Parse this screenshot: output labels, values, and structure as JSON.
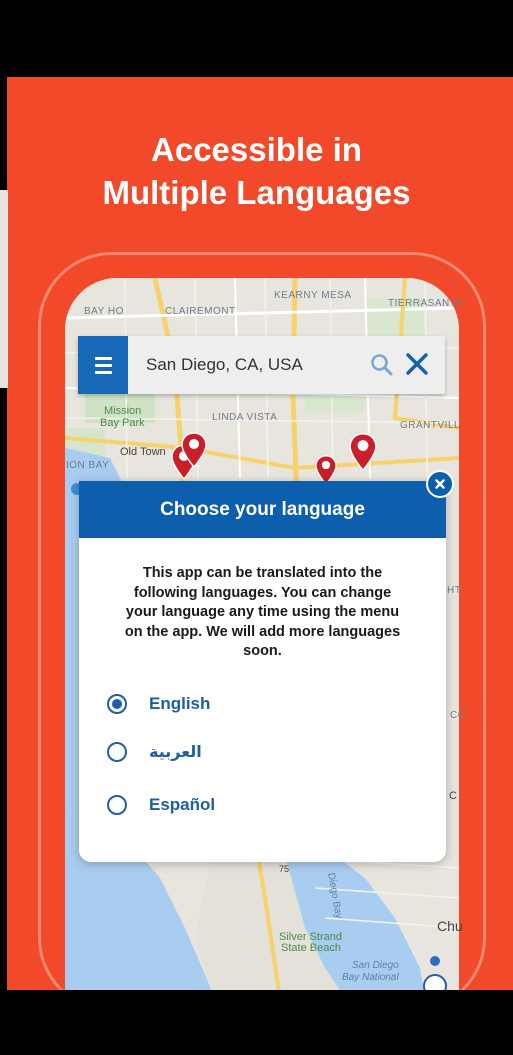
{
  "headline": {
    "line1": "Accessible in",
    "line2": "Multiple Languages"
  },
  "search": {
    "value": "San Diego, CA, USA"
  },
  "map_labels": {
    "bay_ho": "BAY HO",
    "clairemont": "CLAIREMONT",
    "kearny_mesa": "KEARNY MESA",
    "tierrasanta": "TIERRASANTA",
    "mission_bay_park_1": "Mission",
    "mission_bay_park_2": "Bay Park",
    "linda_vista": "LINDA VISTA",
    "grantville": "GRANTVILL",
    "mission_bay": "ION BAY",
    "old_town": "Old Town",
    "silver_strand_1": "Silver Strand",
    "silver_strand_2": "State Beach",
    "san_diego_bay_1": "San Diego",
    "san_diego_bay_2": "Bay National",
    "route_75": "75",
    "chula": "Chu",
    "ht": "HT",
    "co": "CO",
    "c": "C",
    "diego_bay": "Diego Bay"
  },
  "modal": {
    "title": "Choose your language",
    "body": "This app can be translated into the following languages. You can change your language any time using the menu on the app. We will add more languages soon.",
    "options": [
      {
        "label": "English",
        "selected": true
      },
      {
        "label": "العربية",
        "selected": false
      },
      {
        "label": "Español",
        "selected": false
      }
    ]
  },
  "colors": {
    "background": "#f2492a",
    "primary_blue": "#0d5fad",
    "menu_blue": "#1769b7",
    "pin_red": "#c8202a",
    "option_text": "#1e5ea9"
  },
  "icons": {
    "menu": "hamburger-icon",
    "search": "search-icon",
    "clear": "close-icon",
    "modal_close": "close-circle-icon",
    "pin": "map-pin-icon"
  }
}
